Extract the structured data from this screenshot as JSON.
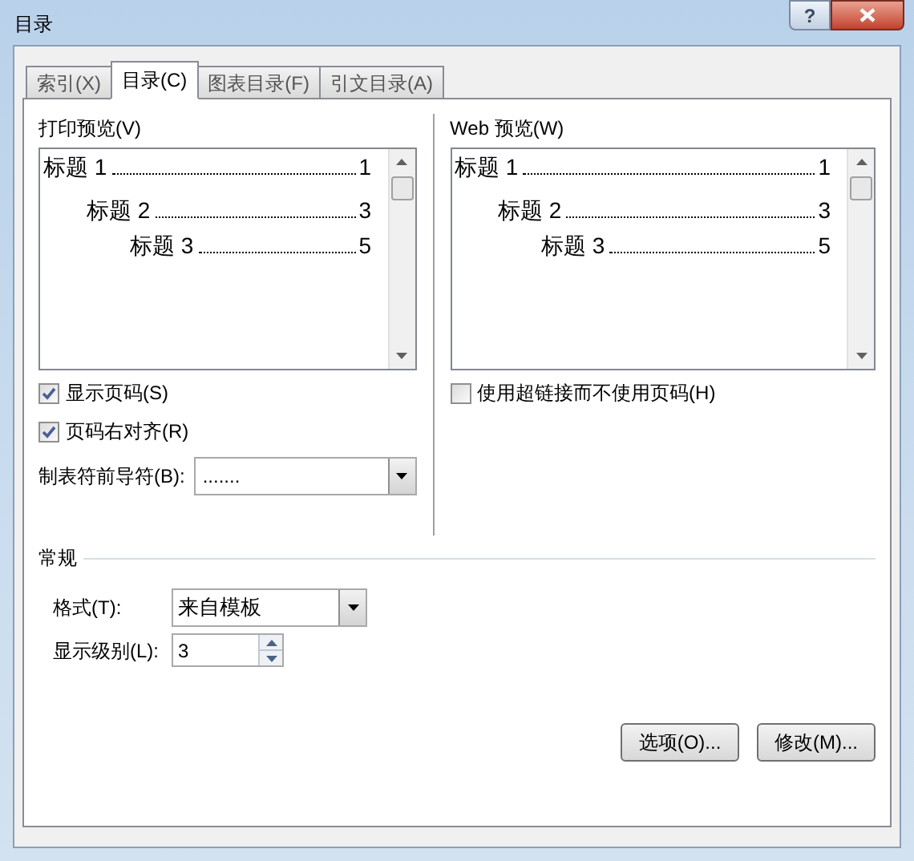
{
  "window": {
    "title": "目录",
    "help_button": "?"
  },
  "tabs": [
    {
      "label": "索引(X)",
      "selected": false
    },
    {
      "label": "目录(C)",
      "selected": true
    },
    {
      "label": "图表目录(F)",
      "selected": false
    },
    {
      "label": "引文目录(A)",
      "selected": false
    }
  ],
  "print_preview": {
    "label": "打印预览(V)",
    "entries": [
      {
        "heading": "标题 1",
        "page": "1",
        "children": [
          {
            "heading": "标题 2",
            "page": "3",
            "children": [
              {
                "heading": "标题 3",
                "page": "5"
              }
            ]
          }
        ]
      }
    ]
  },
  "web_preview": {
    "label": "Web 预览(W)",
    "entries": [
      {
        "heading": "标题 1",
        "page": "1",
        "children": [
          {
            "heading": "标题 2",
            "page": "3",
            "children": [
              {
                "heading": "标题 3",
                "page": "5"
              }
            ]
          }
        ]
      }
    ]
  },
  "print_options": [
    {
      "label": "显示页码(S)",
      "checked": true
    },
    {
      "label": "页码右对齐(R)",
      "checked": true
    }
  ],
  "web_options": [
    {
      "label": "使用超链接而不使用页码(H)",
      "checked": false
    }
  ],
  "tab_leader": {
    "label": "制表符前导符(B):",
    "value": "......."
  },
  "general": {
    "title": "常规",
    "format": {
      "label": "格式(T):",
      "value": "来自模板"
    },
    "levels": {
      "label": "显示级别(L):",
      "value": "3"
    }
  },
  "buttons": [
    "选项(O)...",
    "修改(M)..."
  ]
}
